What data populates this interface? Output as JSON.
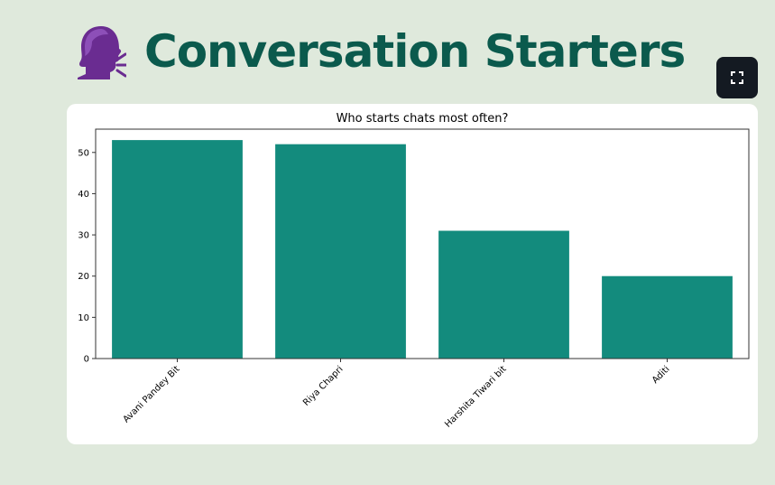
{
  "header": {
    "title": "Conversation Starters",
    "icon": "speaking-head-icon"
  },
  "toolbar": {
    "fullscreen_icon": "expand-icon"
  },
  "colors": {
    "background": "#dfe9dc",
    "title": "#0b5a4d",
    "bar": "#138b7d",
    "button": "#141a22"
  },
  "chart_data": {
    "type": "bar",
    "title": "Who starts chats most often?",
    "categories": [
      "Avani Pandey Bit",
      "Riya Chapri",
      "Harshita Tiwari bit",
      "Aditi"
    ],
    "values": [
      53,
      52,
      31,
      20
    ],
    "ylim": [
      0,
      55.65
    ],
    "yticks": [
      0,
      10,
      20,
      30,
      40,
      50
    ],
    "xlabel": "",
    "ylabel": "",
    "grid": false,
    "x_tick_rotation": 45
  }
}
